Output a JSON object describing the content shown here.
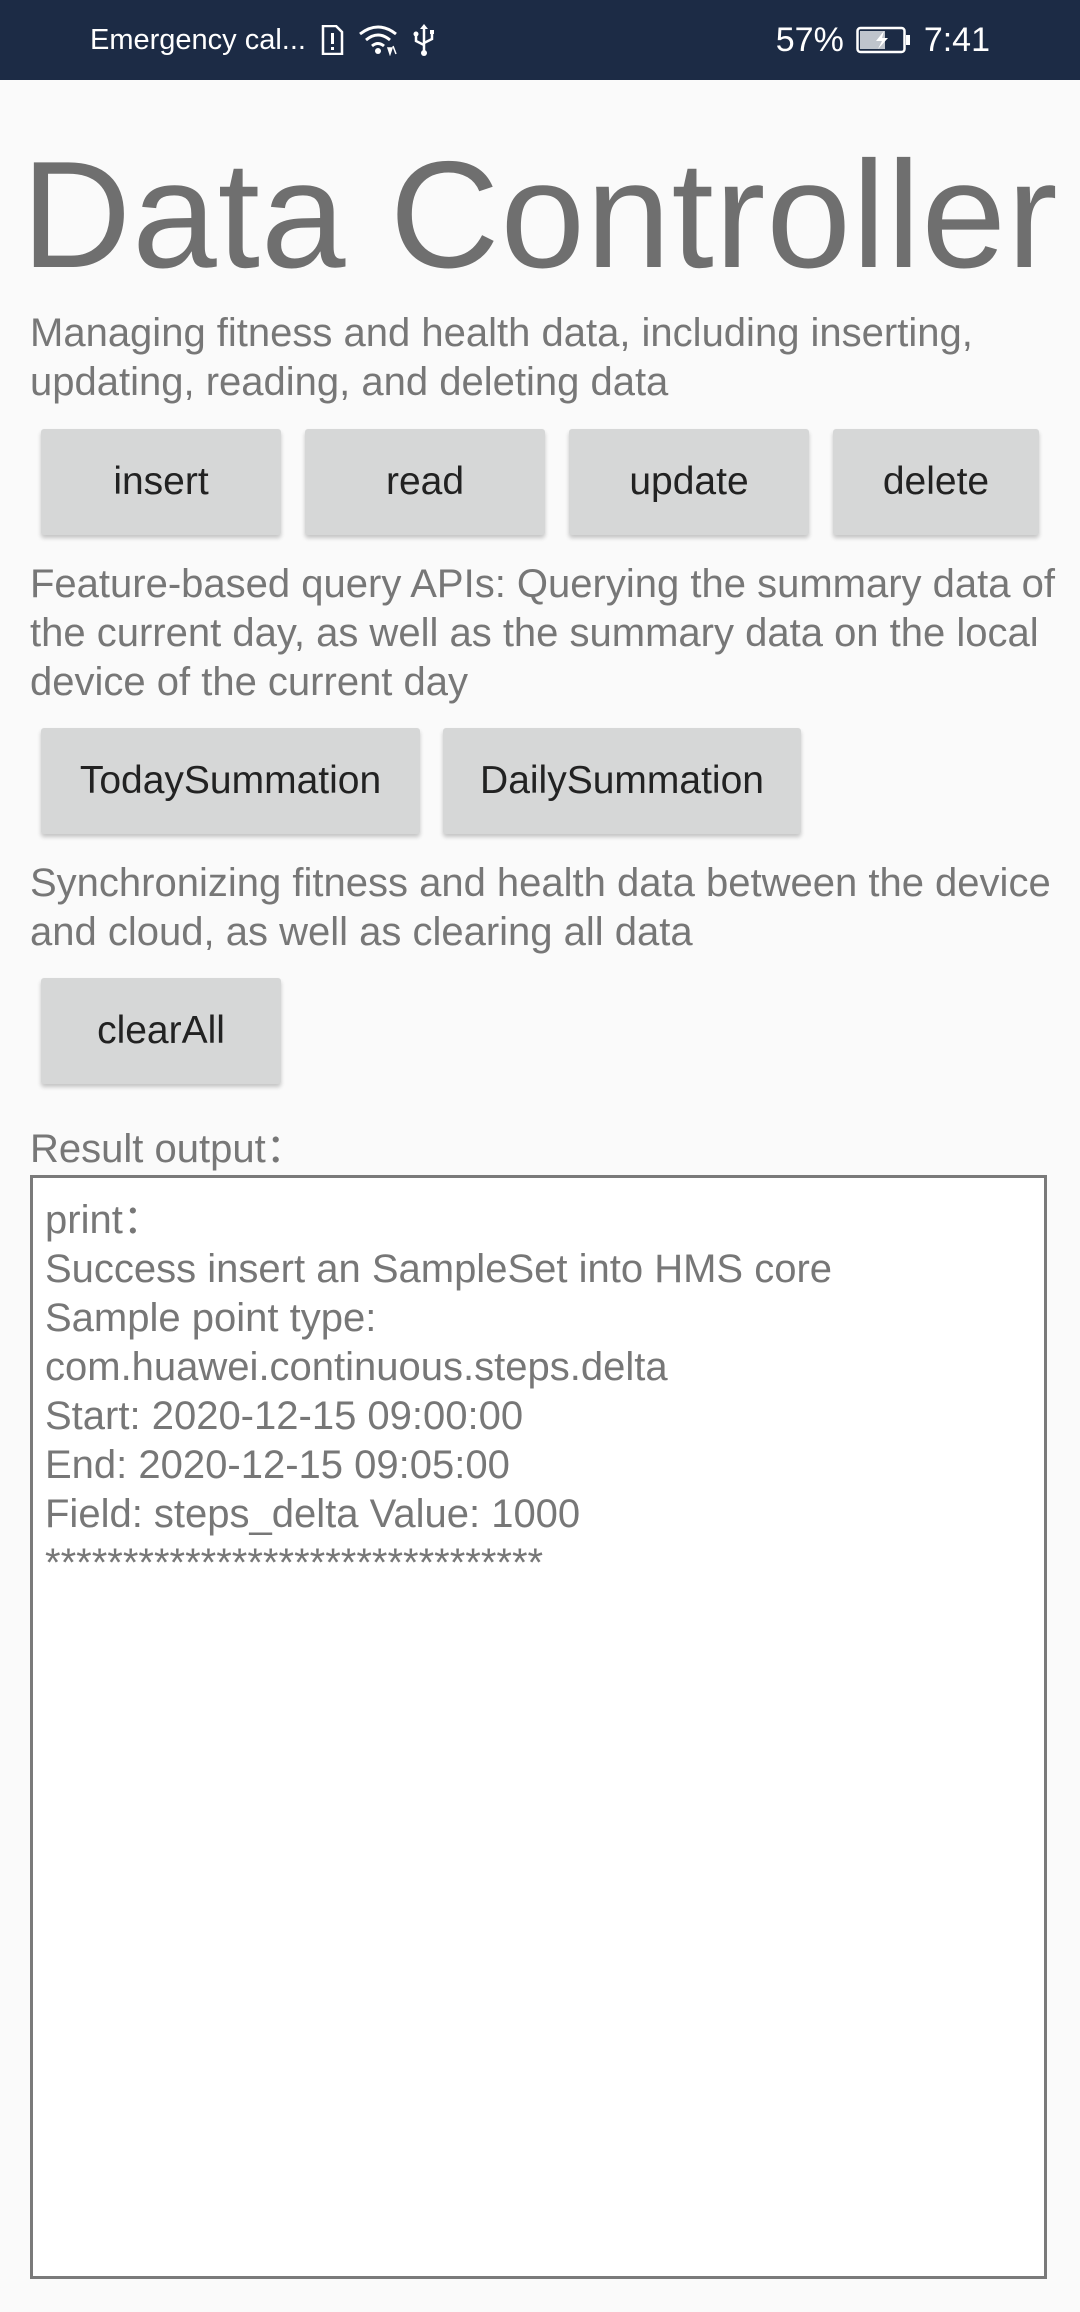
{
  "status_bar": {
    "carrier_text": "Emergency cal...",
    "battery": "57%",
    "time": "7:41",
    "icons": [
      "sim-alert-icon",
      "wifi-icon",
      "usb-icon",
      "battery-charging-icon"
    ]
  },
  "title": "Data Controller",
  "sections": {
    "crud_desc": "Managing fitness and health data, including inserting, updating, reading, and deleting data",
    "query_desc": "Feature-based query APIs: Querying the summary data of the current day, as well as the summary data on the local device of the current day",
    "sync_desc": "Synchronizing fitness and health data between the device and cloud, as well as clearing all data"
  },
  "buttons": {
    "insert": "insert",
    "read": "read",
    "update": "update",
    "delete": "delete",
    "today_summation": "TodaySummation",
    "daily_summation": "DailySummation",
    "clear_all": "clearAll"
  },
  "result": {
    "label": "Result output：",
    "lines": [
      "print：",
      "Success insert an SampleSet into HMS core",
      "Sample point type:",
      "com.huawei.continuous.steps.delta",
      "Start: 2020-12-15 09:00:00",
      "End: 2020-12-15 09:05:00",
      "Field: steps_delta Value: 1000",
      "********************************"
    ]
  },
  "colors": {
    "status_bar_bg": "#1c2b45",
    "page_bg": "#fafafa",
    "button_bg": "#d6d7d7",
    "text_gray": "#777777"
  }
}
